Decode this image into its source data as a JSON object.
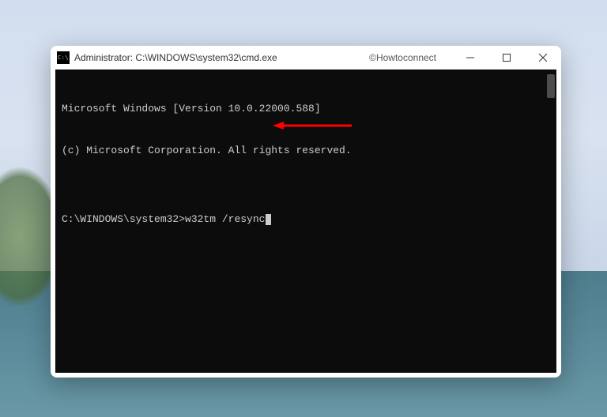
{
  "watermark": "©Howtoconnect",
  "window": {
    "title": "Administrator: C:\\WINDOWS\\system32\\cmd.exe",
    "icon_label": "C:\\"
  },
  "terminal": {
    "line1": "Microsoft Windows [Version 10.0.22000.588]",
    "line2": "(c) Microsoft Corporation. All rights reserved.",
    "blank": "",
    "prompt": "C:\\WINDOWS\\system32>",
    "command": "w32tm /resync"
  },
  "annotation": {
    "arrow_color": "#ff0000"
  }
}
